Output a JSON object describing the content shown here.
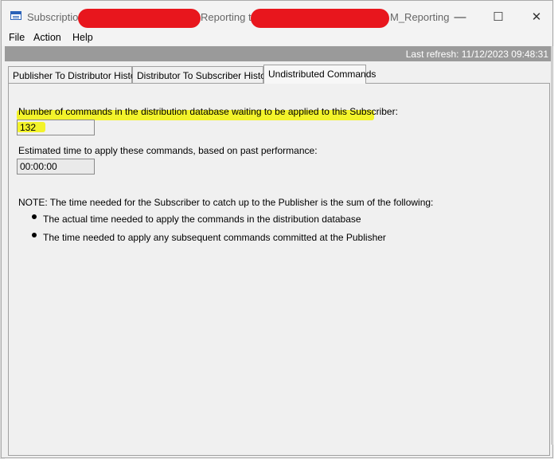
{
  "window": {
    "title_part1": "Subscription",
    "title_part2": "Reporting to",
    "title_part3": "M_Reporting",
    "minimize_glyph": "—",
    "maximize_glyph": "☐",
    "close_glyph": "✕"
  },
  "menu": [
    "File",
    "Action",
    "Help"
  ],
  "status": {
    "last_refresh": "Last refresh: 11/12/2023 09:48:31"
  },
  "tabs": [
    {
      "label": "Publisher To Distributor History",
      "active": false
    },
    {
      "label": "Distributor To Subscriber History",
      "active": false
    },
    {
      "label": "Undistributed Commands",
      "active": true
    }
  ],
  "undistributed": {
    "commands_label": "Number of commands in the distribution database waiting to be applied to this Subscriber:",
    "commands_value": "132",
    "estimate_label": "Estimated time to apply these commands, based on past performance:",
    "estimate_value": "00:00:00",
    "note": "NOTE: The time needed for the Subscriber to catch up to the Publisher is the sum of the following:",
    "bullets": [
      "The actual time needed to apply the commands in the distribution database",
      "The time needed to apply any subsequent commands committed at the Publisher"
    ]
  },
  "colors": {
    "highlight": "#f3f32a",
    "redaction": "#e8161d",
    "status_bar": "#9a9a9a"
  }
}
